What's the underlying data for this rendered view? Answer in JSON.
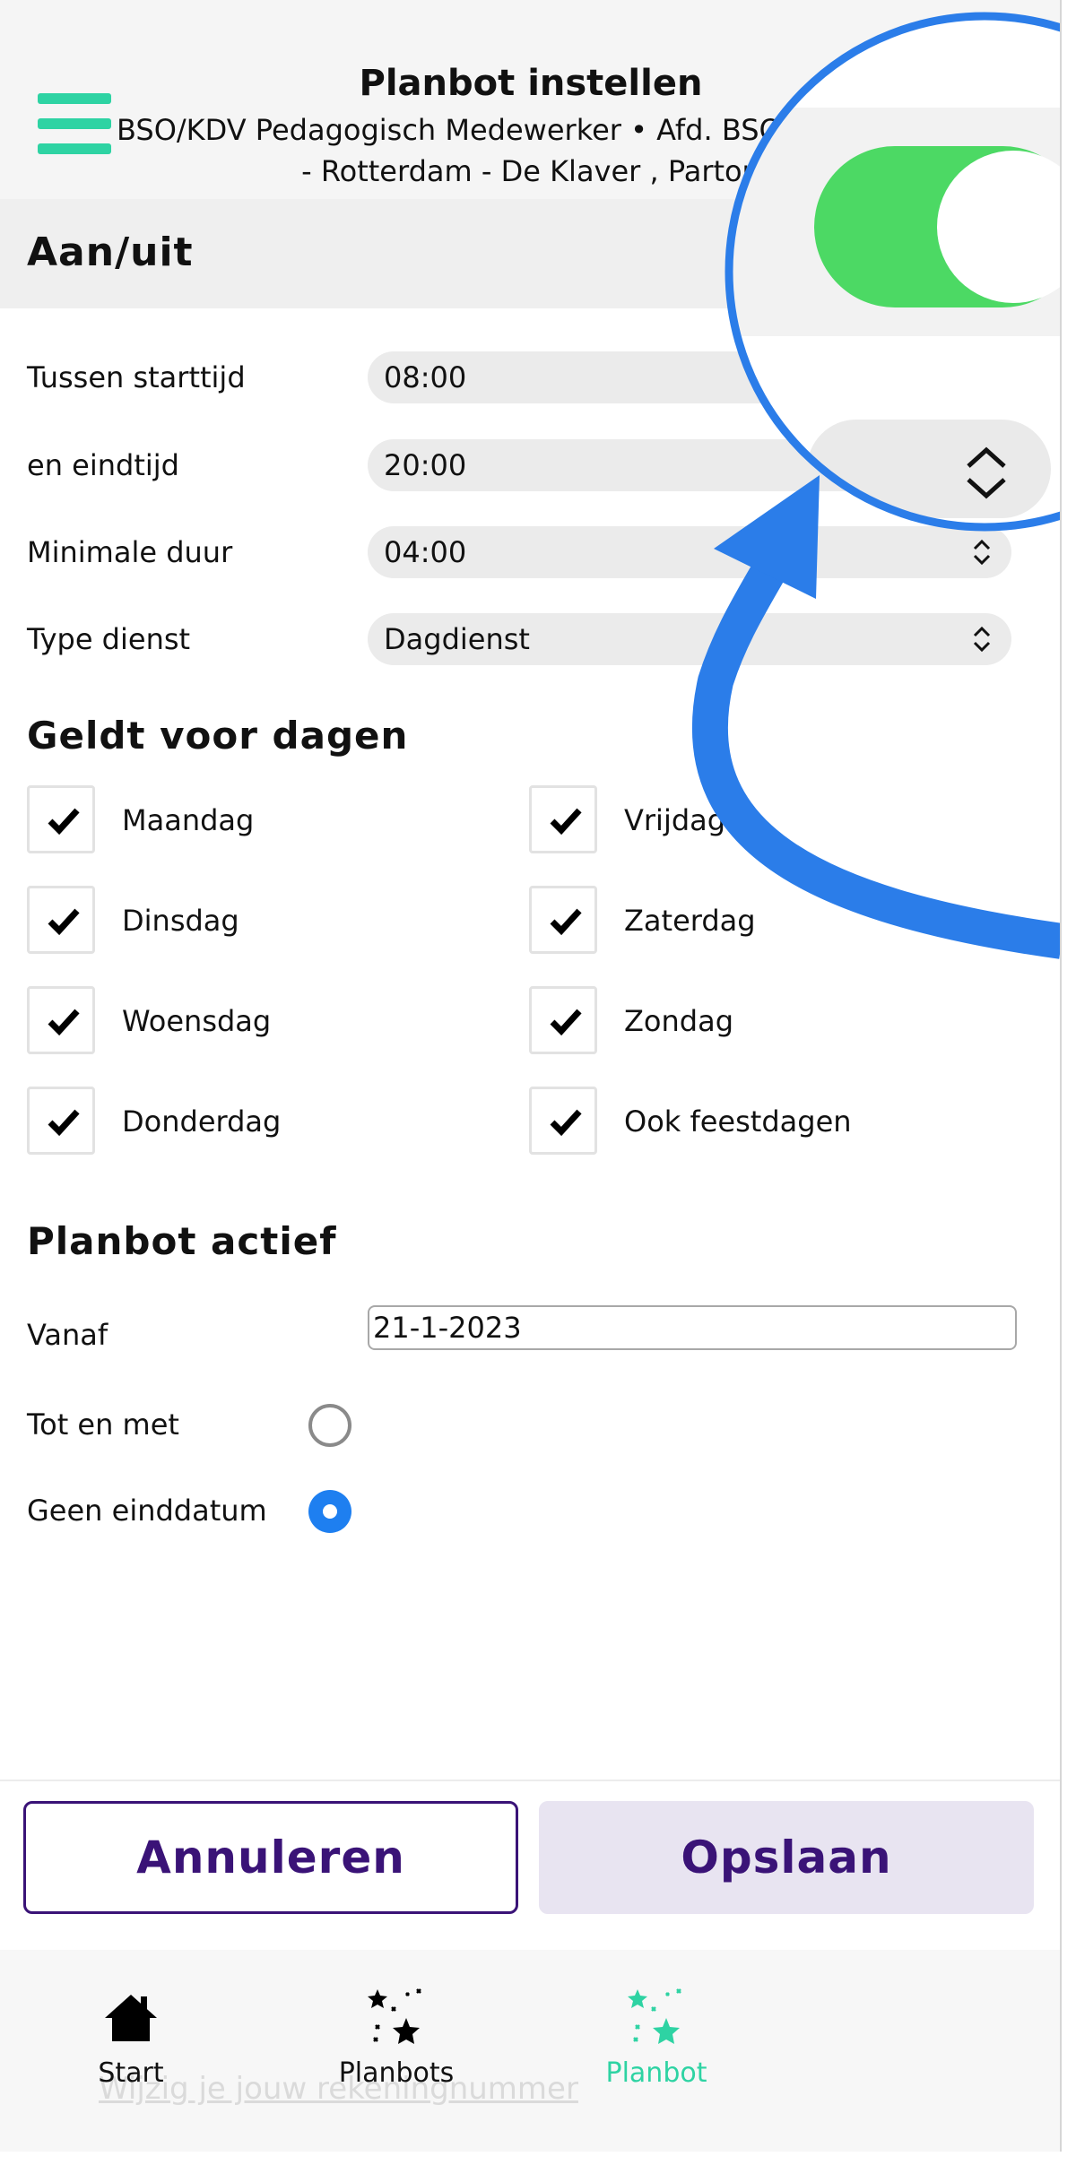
{
  "header": {
    "title": "Planbot instellen",
    "subtitle_line1": "BSO/KDV Pedagogisch Medewerker • Afd. BSO, Ro",
    "subtitle_line2": "- Rotterdam - De Klaver , Partou"
  },
  "toggle_section": {
    "label": "Aan/uit",
    "enabled": true
  },
  "fields": {
    "start": {
      "label": "Tussen starttijd",
      "value": "08:00"
    },
    "end": {
      "label": "en eindtijd",
      "value": "20:00"
    },
    "min_duration": {
      "label": "Minimale duur",
      "value": "04:00"
    },
    "shift_type": {
      "label": "Type dienst",
      "value": "Dagdienst"
    }
  },
  "days_section": {
    "title": "Geldt voor dagen",
    "days": [
      {
        "label": "Maandag",
        "checked": true
      },
      {
        "label": "Dinsdag",
        "checked": true
      },
      {
        "label": "Woensdag",
        "checked": true
      },
      {
        "label": "Donderdag",
        "checked": true
      },
      {
        "label": "Vrijdag",
        "checked": true
      },
      {
        "label": "Zaterdag",
        "checked": true
      },
      {
        "label": "Zondag",
        "checked": true
      },
      {
        "label": "Ook feestdagen",
        "checked": true
      }
    ]
  },
  "active_section": {
    "title": "Planbot actief",
    "from_label": "Vanaf",
    "from_value": "21-1-2023",
    "until_label": "Tot en met",
    "no_end_label": "Geen einddatum",
    "selected": "Geen einddatum"
  },
  "buttons": {
    "cancel": "Annuleren",
    "save": "Opslaan"
  },
  "bottom_nav": {
    "ghost_text": "Wijzig je jouw rekeningnummer",
    "items": [
      {
        "label": "Start",
        "icon": "home-icon",
        "active": false
      },
      {
        "label": "Planbots",
        "icon": "stars-icon",
        "active": false
      },
      {
        "label": "Planbot",
        "icon": "stars-icon",
        "active": true
      }
    ]
  },
  "colors": {
    "accent_green": "#2ed3a3",
    "toggle_green": "#4cd964",
    "primary_purple": "#3a1377",
    "radio_blue": "#1e7ff0",
    "annotation_blue": "#2b7de9"
  }
}
